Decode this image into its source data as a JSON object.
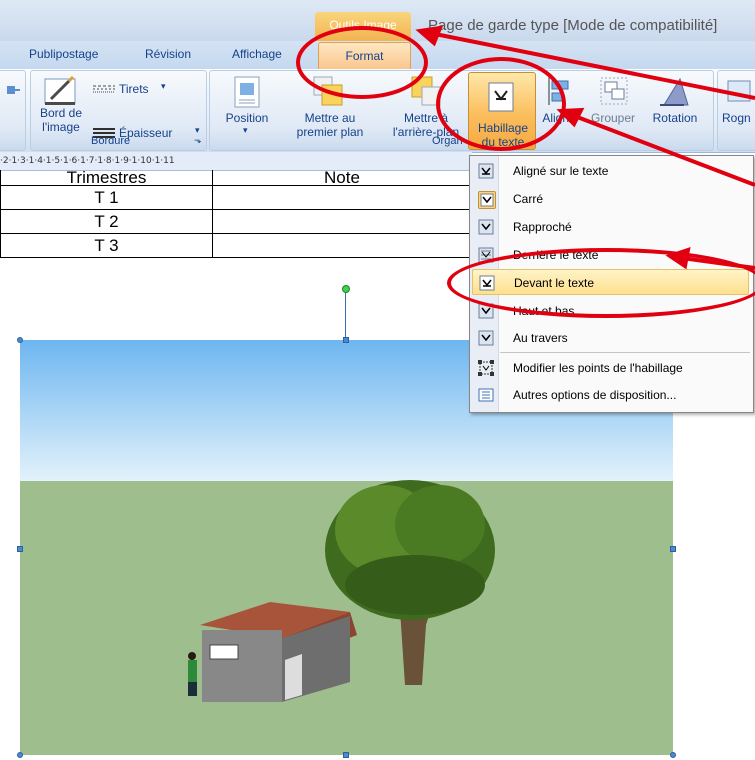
{
  "window": {
    "contextual_tab": "Outils Image",
    "title": "Page de garde type [Mode de compatibilité]"
  },
  "tabs": [
    "Publipostage",
    "Révision",
    "Affichage",
    "Format"
  ],
  "ribbon": {
    "bordure_group": {
      "label": "Bordure",
      "bord_image_label": "Bord de\nl'image",
      "tirets_label": "Tirets",
      "epaisseur_label": "Épaisseur"
    },
    "organiser_group": {
      "label": "Organ",
      "position_label": "Position",
      "premier_plan_label": "Mettre au\npremier plan",
      "arriere_plan_label": "Mettre à\nl'arrière-plan",
      "habillage_label": "Habillage\ndu texte",
      "aligner_label": "Aligner",
      "grouper_label": "Grouper",
      "rotation_label": "Rotation"
    },
    "rogner_label": "Rogn"
  },
  "ruler": "·2·1·3·1·4·1·5·1·6·1·7·1·8·1·9·1·10·1·11",
  "table": {
    "header": [
      "Trimestres",
      "Note"
    ],
    "rows": [
      [
        "T 1",
        ""
      ],
      [
        "T 2",
        ""
      ],
      [
        "T 3",
        ""
      ]
    ]
  },
  "menu": {
    "items": [
      {
        "label": "Aligné sur le texte",
        "icon": "inline-text-icon"
      },
      {
        "label": "Carré",
        "icon": "square-wrap-icon"
      },
      {
        "label": "Rapproché",
        "icon": "tight-wrap-icon"
      },
      {
        "label": "Derrière le texte",
        "icon": "behind-text-icon"
      },
      {
        "label": "Devant le texte",
        "icon": "in-front-text-icon"
      },
      {
        "label": "Haut et bas",
        "icon": "top-bottom-icon"
      },
      {
        "label": "Au travers",
        "icon": "through-icon"
      },
      {
        "label": "Modifier les points de l'habillage",
        "icon": "edit-wrap-points-icon"
      },
      {
        "label": "Autres options de disposition...",
        "icon": "more-layout-icon"
      }
    ],
    "highlighted_index": 4
  },
  "colors": {
    "annotation": "#e0000f",
    "accent_orange": "#f6a942",
    "ribbon_text": "#15428b"
  }
}
